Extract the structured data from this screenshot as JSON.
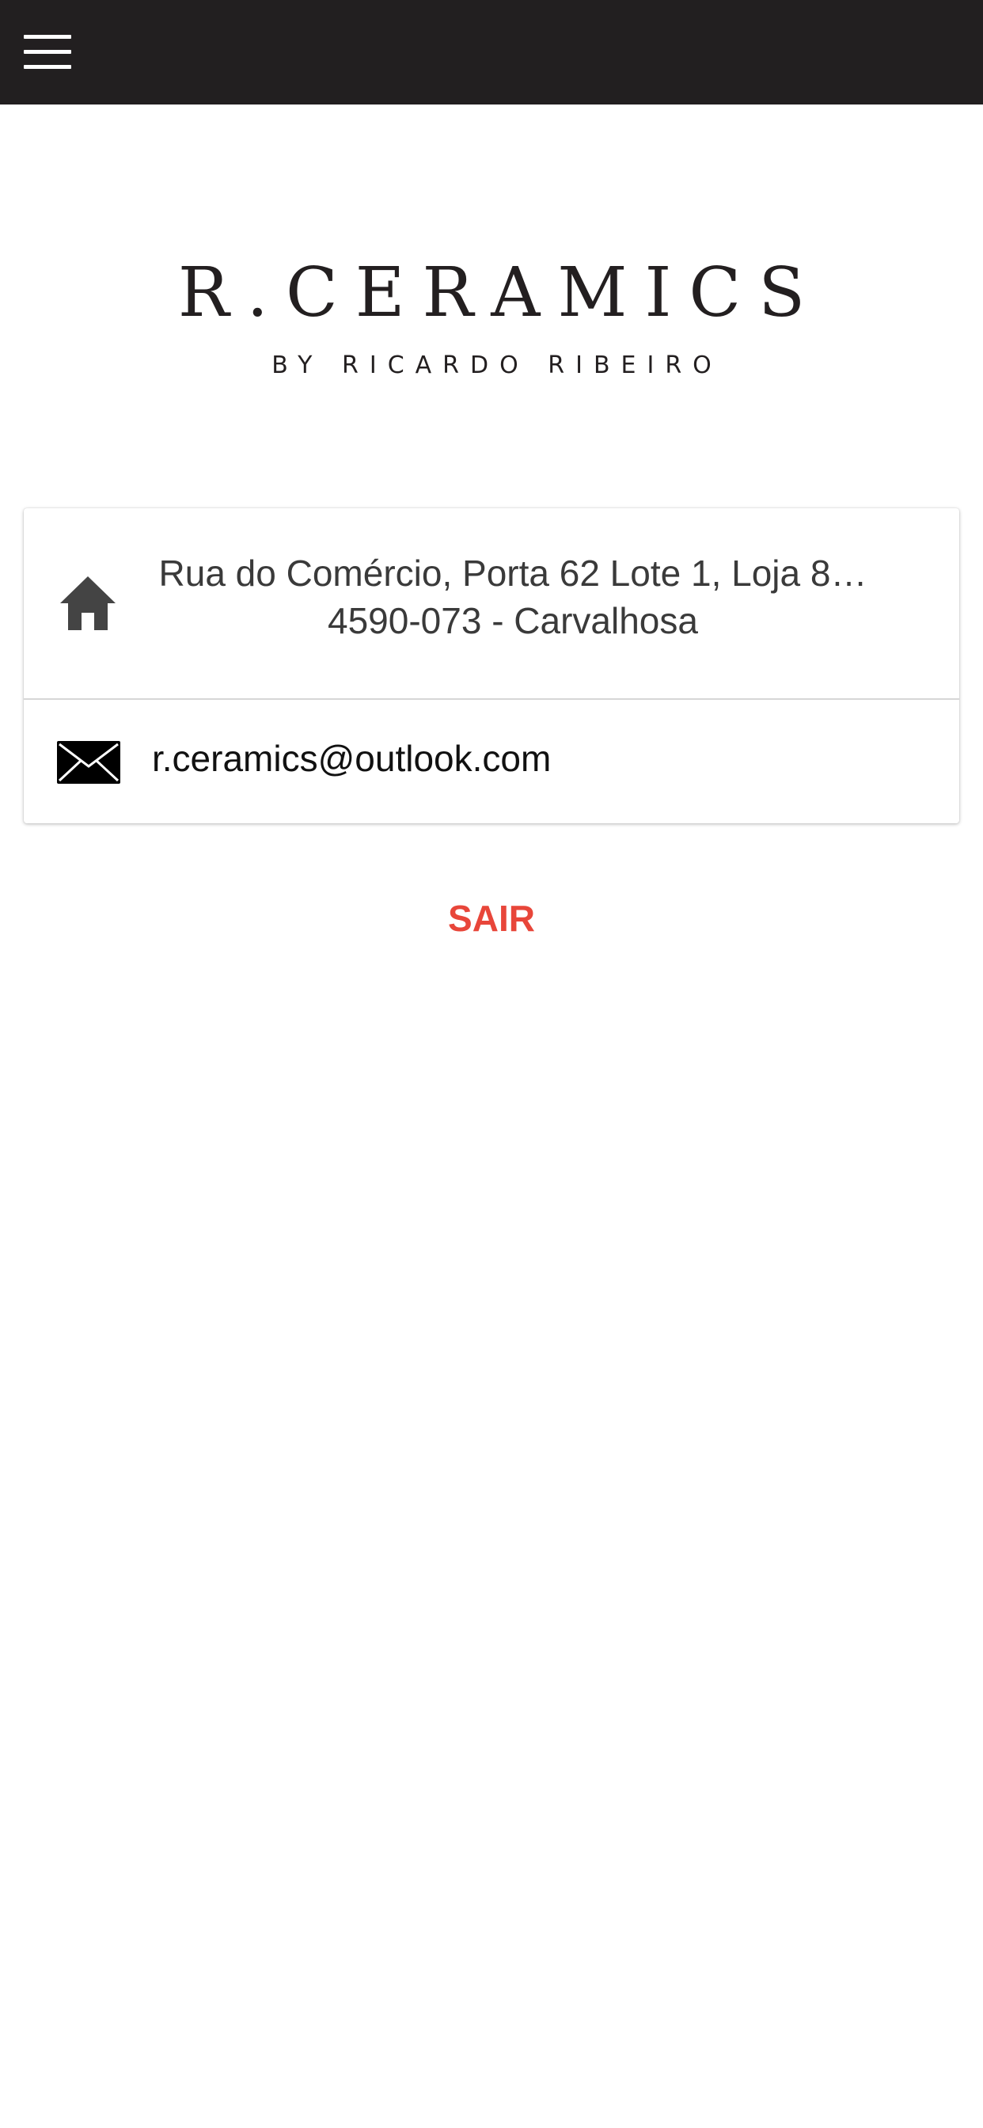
{
  "header": {
    "menu_icon": "hamburger-menu-icon",
    "background": "#221f20"
  },
  "logo": {
    "title": "R.CERAMICS",
    "subtitle": "BY RICARDO RIBEIRO"
  },
  "contact": {
    "address": {
      "icon": "home-icon",
      "line1": "Rua do Comércio, Porta 62 Lote 1, Loja 8…",
      "line2": "4590-073 - Carvalhosa"
    },
    "email": {
      "icon": "mail-icon",
      "value": "r.ceramics@outlook.com"
    }
  },
  "logout": {
    "label": "SAIR",
    "color": "#e8463a"
  }
}
